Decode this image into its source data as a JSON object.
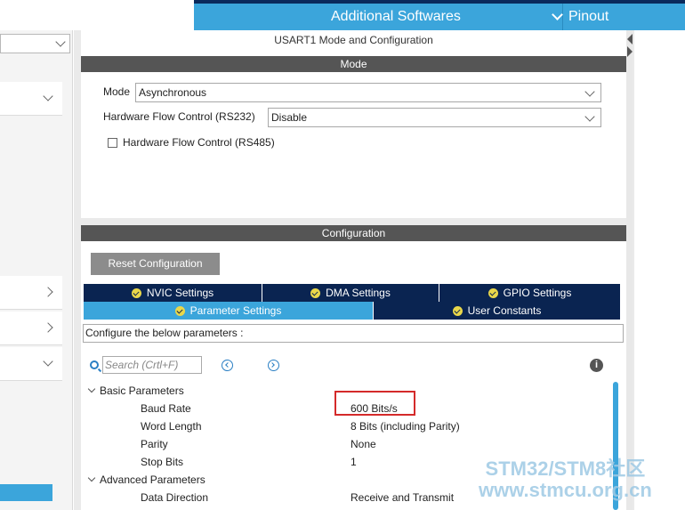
{
  "topbar": {
    "additional_softwares": "Additional Softwares",
    "pinout": "Pinout"
  },
  "panel": {
    "title": "USART1 Mode and Configuration",
    "mode_header": "Mode",
    "mode_label": "Mode",
    "mode_value": "Asynchronous",
    "hwfc232_label": "Hardware Flow Control (RS232)",
    "hwfc232_value": "Disable",
    "hwfc485_label": "Hardware Flow Control (RS485)",
    "config_header": "Configuration",
    "reset_button": "Reset Configuration"
  },
  "tabs": [
    {
      "label": "NVIC Settings",
      "active": false
    },
    {
      "label": "DMA Settings",
      "active": false
    },
    {
      "label": "GPIO Settings",
      "active": false
    },
    {
      "label": "Parameter Settings",
      "active": true
    },
    {
      "label": "User Constants",
      "active": false
    }
  ],
  "configure_text": "Configure the below parameters :",
  "search": {
    "placeholder": "Search (Crtl+F)"
  },
  "params": {
    "basic_group": "Basic Parameters",
    "advanced_group": "Advanced Parameters",
    "rows": [
      {
        "name": "Baud Rate",
        "value": "600 Bits/s"
      },
      {
        "name": "Word Length",
        "value": "8 Bits (including Parity)"
      },
      {
        "name": "Parity",
        "value": "None"
      },
      {
        "name": "Stop Bits",
        "value": "1"
      },
      {
        "name": "Data Direction",
        "value": "Receive and Transmit"
      }
    ]
  },
  "watermark": {
    "line1": "STM32/STM8社区",
    "line2": "www.stmcu.org.cn"
  },
  "colors": {
    "accent": "#3ba5db",
    "navy": "#0a2451",
    "header_gray": "#555555",
    "highlight_red": "#d42a2a"
  }
}
